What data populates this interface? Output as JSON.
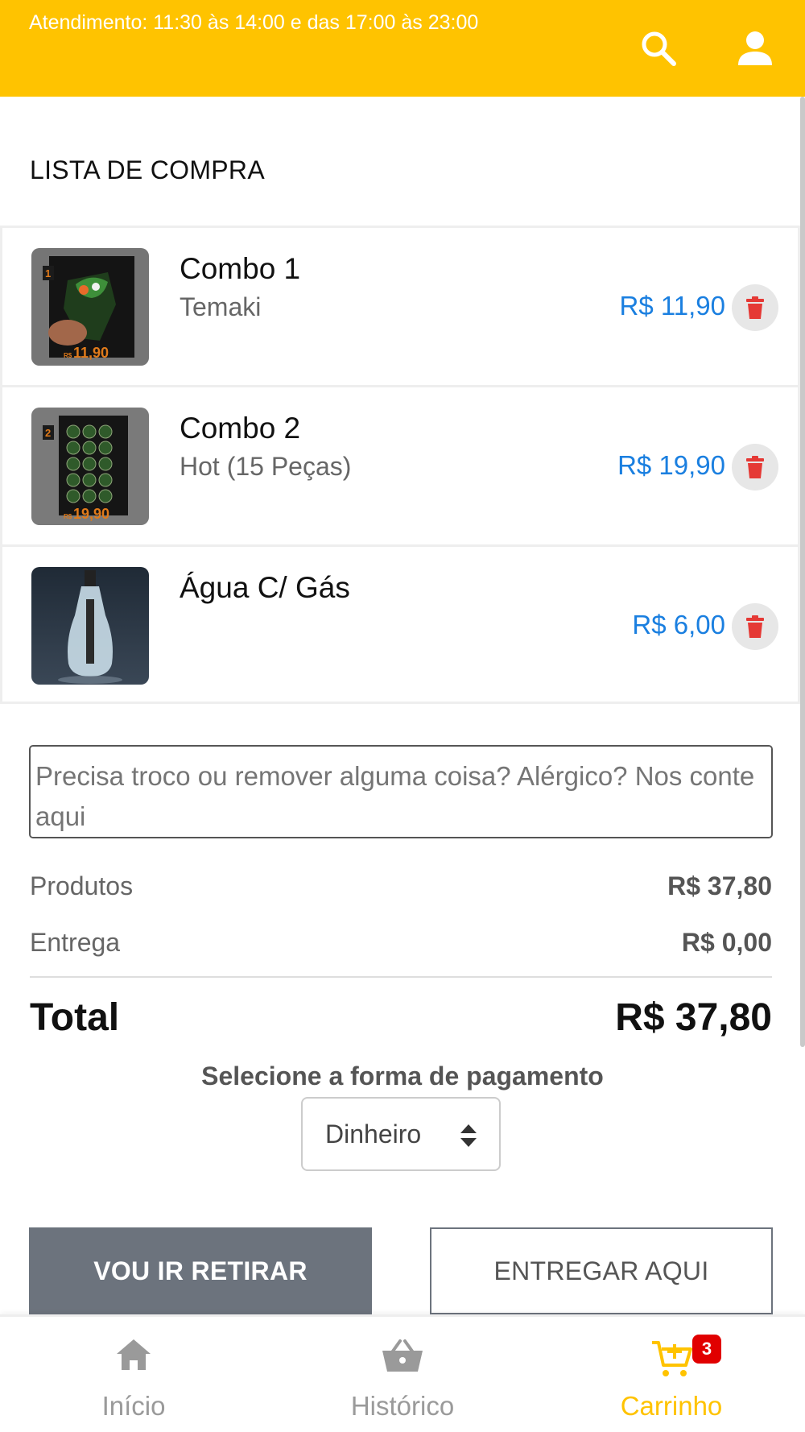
{
  "header": {
    "hours_text": "Atendimento: 11:30 às 14:00 e das 17:00 às 23:00",
    "background_color": "#FFC300",
    "icons": [
      "search-icon",
      "user-icon"
    ]
  },
  "cart": {
    "title": "LISTA DE COMPRA",
    "items": [
      {
        "name": "Combo 1",
        "description": "Temaki",
        "price": "R$ 11,90",
        "image_number": "1",
        "image_price": "R$11,90"
      },
      {
        "name": "Combo 2",
        "description": "Hot (15 Peças)",
        "price": "R$ 19,90",
        "image_number": "2",
        "image_price": "R$19,90"
      },
      {
        "name": "Água C/ Gás",
        "description": "",
        "price": "R$ 6,00"
      }
    ]
  },
  "notes": {
    "placeholder": "Precisa troco ou remover alguma coisa? Alérgico? Nos conte aqui"
  },
  "summary": {
    "products_label": "Produtos",
    "products_value": "R$ 37,80",
    "delivery_label": "Entrega",
    "delivery_value": "R$ 0,00",
    "total_label": "Total",
    "total_value": "R$ 37,80"
  },
  "payment": {
    "title": "Selecione a forma de pagamento",
    "selected": "Dinheiro"
  },
  "actions": {
    "pickup_label": "VOU IR RETIRAR",
    "deliver_label": "ENTREGAR AQUI"
  },
  "bottom_nav": {
    "home_label": "Início",
    "history_label": "Histórico",
    "cart_label": "Carrinho",
    "cart_badge": "3",
    "active_color": "#FFC300"
  }
}
